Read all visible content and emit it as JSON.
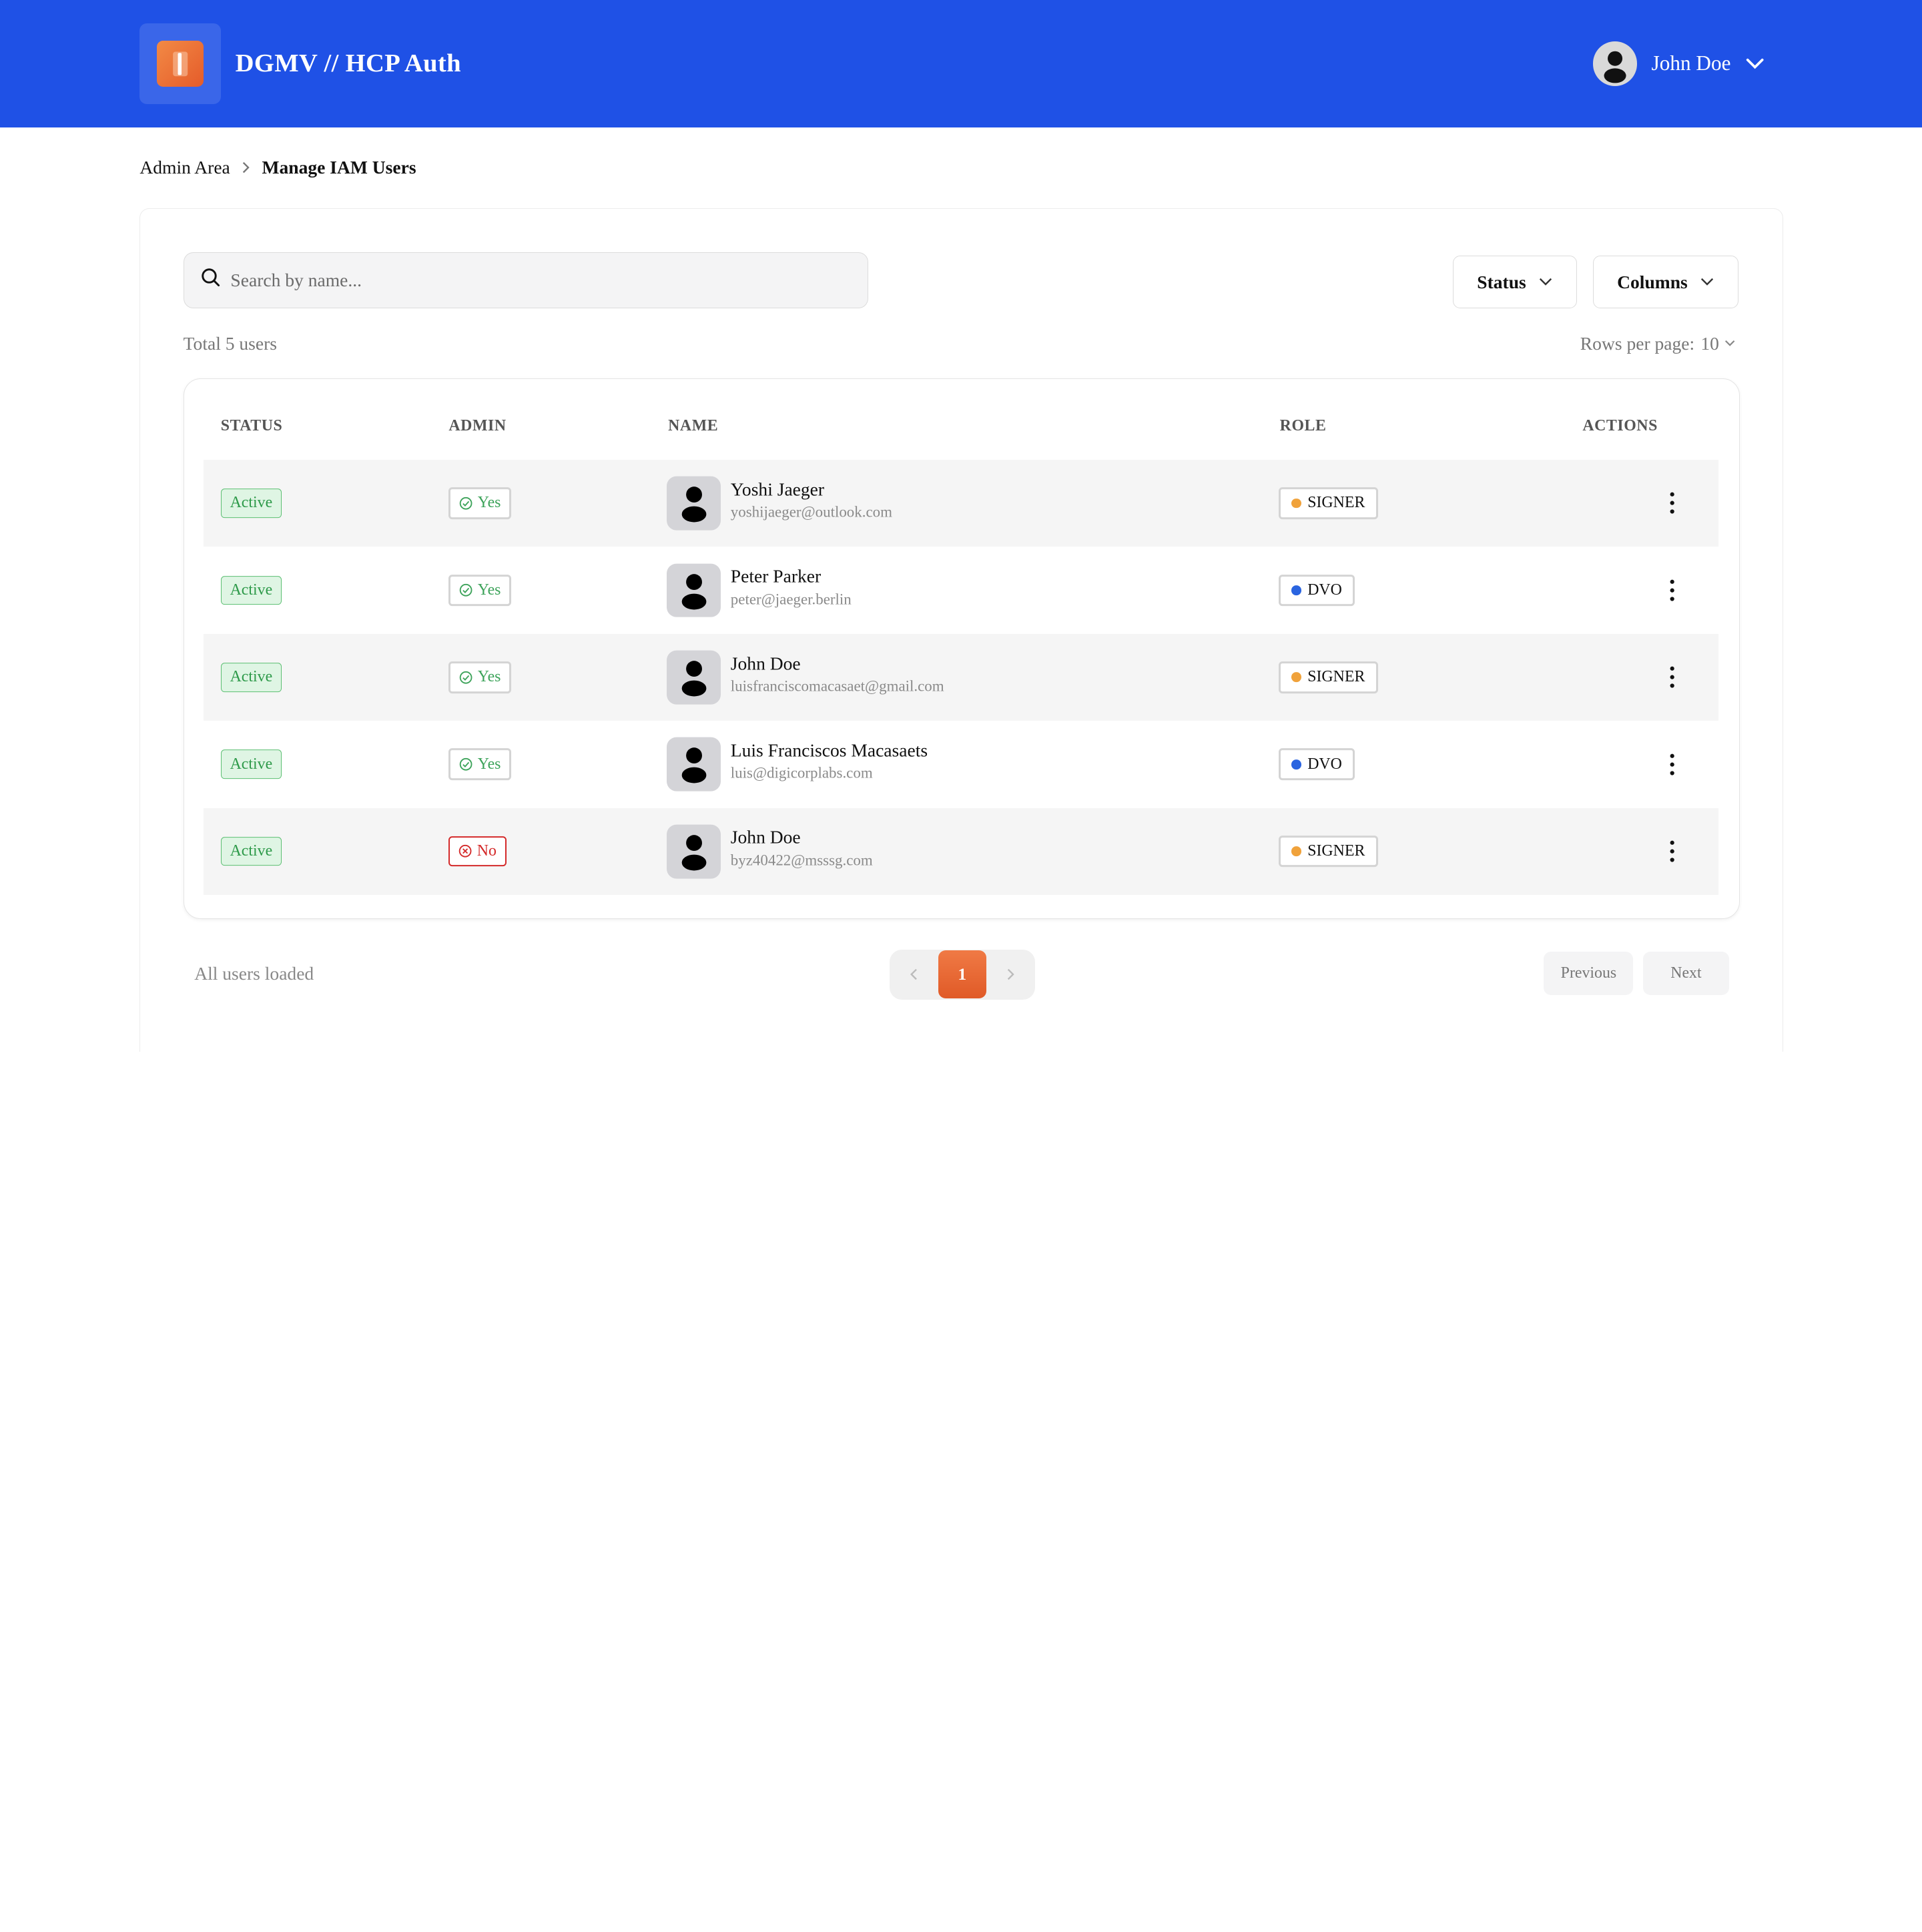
{
  "app": {
    "title": "DGMV // HCP Auth",
    "accent_color": "#1f51e6",
    "logo_icon": "app-logo-icon"
  },
  "header": {
    "user_name": "John Doe",
    "avatar_icon": "user-avatar-icon",
    "menu_icon": "chevron-down-icon"
  },
  "breadcrumb": {
    "parent": "Admin Area",
    "current": "Manage IAM Users"
  },
  "toolbar": {
    "search_placeholder": "Search by name...",
    "status_label": "Status",
    "columns_label": "Columns",
    "total_text": "Total 5 users",
    "rows_per_page_label": "Rows per page:",
    "rows_per_page_value": "10"
  },
  "table": {
    "columns": [
      "STATUS",
      "ADMIN",
      "NAME",
      "ROLE",
      "ACTIONS"
    ],
    "rows": [
      {
        "status": "Active",
        "admin": "Yes",
        "admin_yes": true,
        "name": "Yoshi Jaeger",
        "email": "yoshijaeger@outlook.com",
        "role": "SIGNER",
        "role_color": "#f0a23b"
      },
      {
        "status": "Active",
        "admin": "Yes",
        "admin_yes": true,
        "name": "Peter Parker",
        "email": "peter@jaeger.berlin",
        "role": "DVO",
        "role_color": "#2a64e0"
      },
      {
        "status": "Active",
        "admin": "Yes",
        "admin_yes": true,
        "name": "John Doe",
        "email": "luisfranciscomacasaet@gmail.com",
        "role": "SIGNER",
        "role_color": "#f0a23b"
      },
      {
        "status": "Active",
        "admin": "Yes",
        "admin_yes": true,
        "name": "Luis Franciscos Macasaets",
        "email": "luis@digicorplabs.com",
        "role": "DVO",
        "role_color": "#2a64e0"
      },
      {
        "status": "Active",
        "admin": "No",
        "admin_yes": false,
        "name": "John Doe",
        "email": "byz40422@msssg.com",
        "role": "SIGNER",
        "role_color": "#f0a23b"
      }
    ]
  },
  "footer": {
    "loaded_text": "All users loaded",
    "current_page": "1",
    "previous_label": "Previous",
    "next_label": "Next",
    "page_active_color": "#e8682f"
  }
}
